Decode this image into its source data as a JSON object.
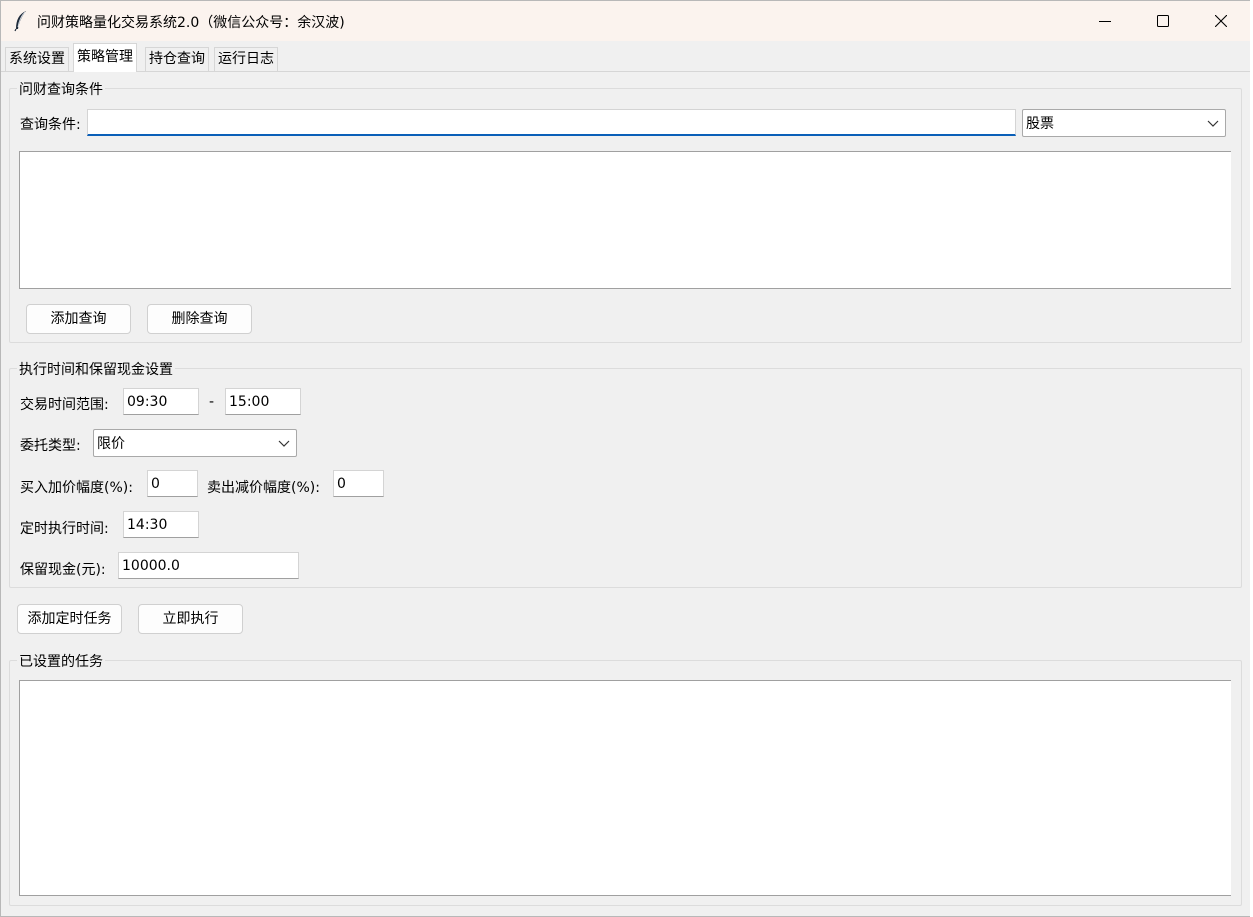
{
  "window": {
    "title": "问财策略量化交易系统2.0（微信公众号：余汉波)",
    "icons": {
      "app": "feather-icon",
      "minimize": "minimize-icon",
      "maximize": "maximize-icon",
      "close": "close-icon"
    }
  },
  "tabs": [
    {
      "label": "系统设置",
      "active": false
    },
    {
      "label": "策略管理",
      "active": true
    },
    {
      "label": "持仓查询",
      "active": false
    },
    {
      "label": "运行日志",
      "active": false
    }
  ],
  "query_group": {
    "title": "问财查询条件",
    "condition_label": "查询条件:",
    "condition_value": "",
    "type_select": {
      "selected": "股票"
    },
    "add_button": "添加查询",
    "delete_button": "删除查询"
  },
  "time_group": {
    "title": "执行时间和保留现金设置",
    "trade_time_label": "交易时间范围:",
    "start_time": "09:30",
    "separator": "-",
    "end_time": "15:00",
    "order_type_label": "委托类型:",
    "order_type_selected": "限价",
    "buy_markup_label": "买入加价幅度(%):",
    "buy_markup_value": "0",
    "sell_markdown_label": "卖出减价幅度(%):",
    "sell_markdown_value": "0",
    "schedule_time_label": "定时执行时间:",
    "schedule_time_value": "14:30",
    "reserve_cash_label": "保留现金(元):",
    "reserve_cash_value": "10000.0"
  },
  "actions": {
    "add_task_button": "添加定时任务",
    "run_now_button": "立即执行"
  },
  "tasks_group": {
    "title": "已设置的任务"
  },
  "colors": {
    "titlebar": "#fbf3ee",
    "window_bg": "#f0f0f0",
    "focus_accent": "#0a5fb8"
  }
}
